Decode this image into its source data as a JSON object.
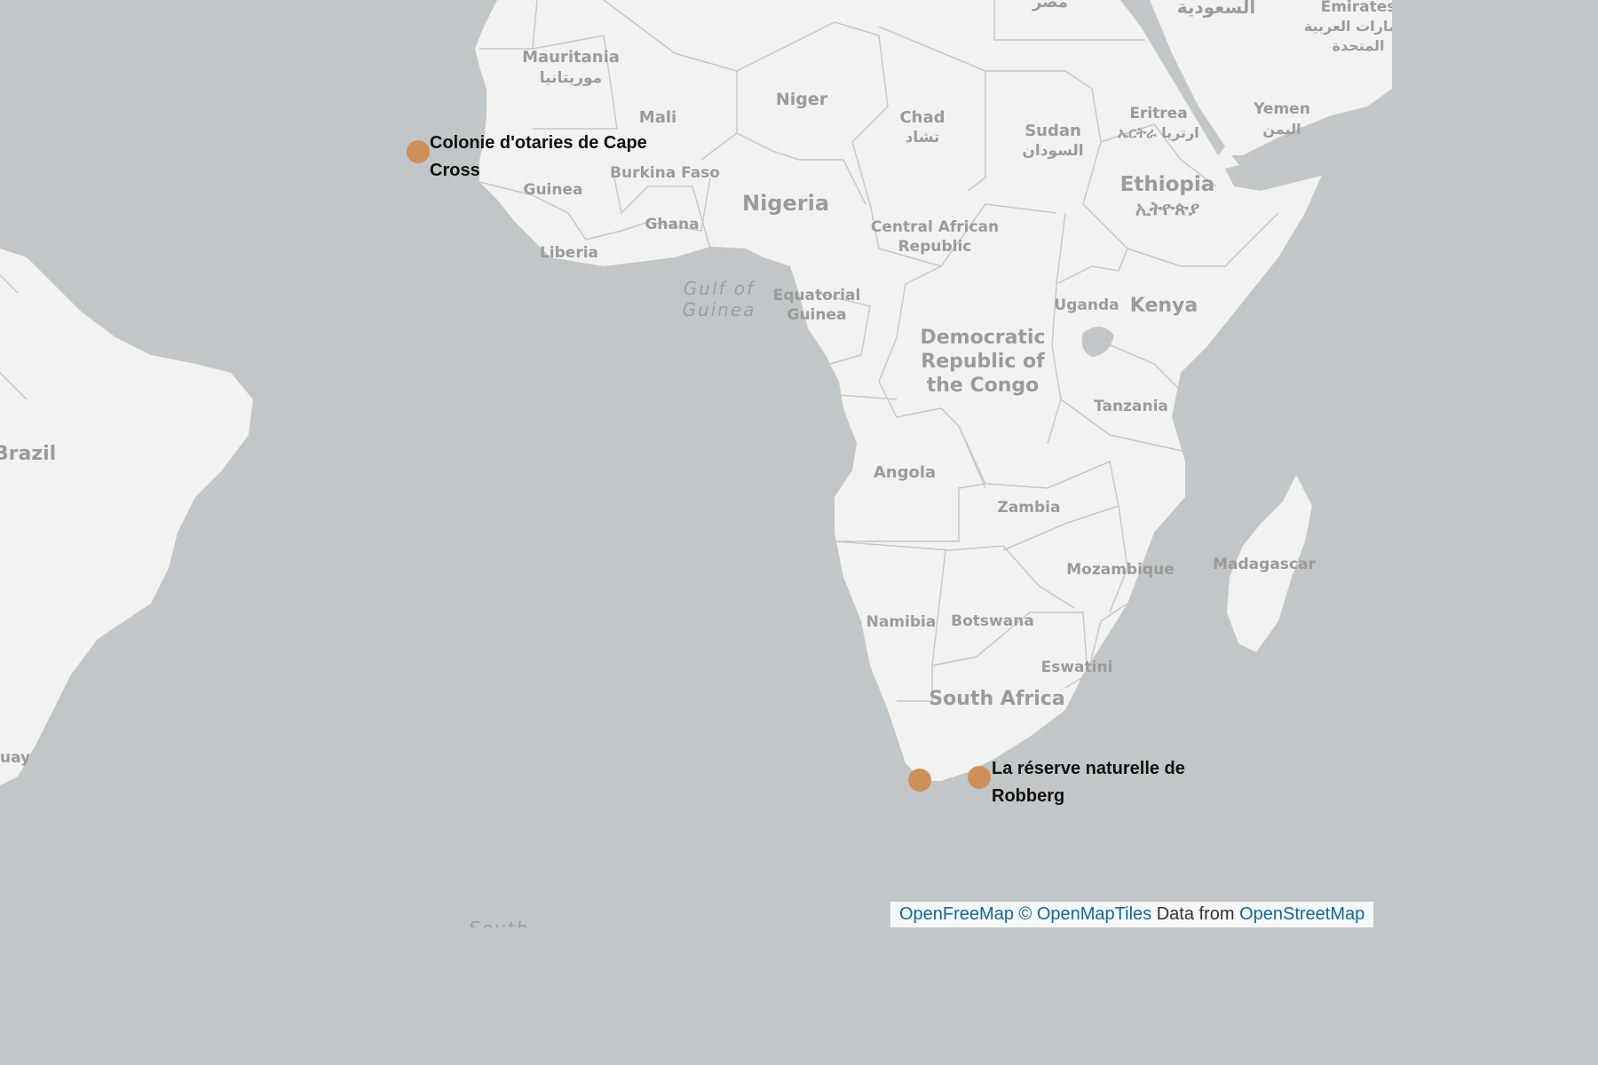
{
  "map": {
    "countries": [
      {
        "name": "Mauritania",
        "native": "موريتانيا"
      },
      {
        "name": "Mali"
      },
      {
        "name": "Niger"
      },
      {
        "name": "Chad",
        "native": "تشاد"
      },
      {
        "name": "Sudan",
        "native": "السودان"
      },
      {
        "name": "Eritrea",
        "native": "ኤርትራ ارتريا"
      },
      {
        "name": "Yemen",
        "native": "اليمن"
      },
      {
        "name": "Ethiopia",
        "native": "ኢትዮጵያ"
      },
      {
        "name": "Nigeria"
      },
      {
        "name": "Guinea"
      },
      {
        "name": "Burkina Faso"
      },
      {
        "name": "Ghana"
      },
      {
        "name": "Liberia"
      },
      {
        "name": "Central African Republic"
      },
      {
        "name": "Equatorial Guinea"
      },
      {
        "name": "Uganda"
      },
      {
        "name": "Kenya"
      },
      {
        "name": "Democratic Republic of the Congo"
      },
      {
        "name": "Tanzania"
      },
      {
        "name": "Angola"
      },
      {
        "name": "Zambia"
      },
      {
        "name": "Mozambique"
      },
      {
        "name": "Madagascar"
      },
      {
        "name": "Namibia"
      },
      {
        "name": "Botswana"
      },
      {
        "name": "Eswatini"
      },
      {
        "name": "South Africa"
      },
      {
        "name": "Brazil"
      },
      {
        "name": "uay"
      },
      {
        "name": "مصر"
      },
      {
        "name": "السعودية"
      },
      {
        "name": "Emirates",
        "native": "الإمارات العربية المتحدة"
      }
    ],
    "water_bodies": [
      {
        "name": "Gulf of Guinea"
      },
      {
        "name": "South"
      }
    ],
    "markers": [
      {
        "label_line1": "Colonie d'otaries de Cape",
        "label_line2": "Cross",
        "color": "#cf8f5a"
      },
      {
        "label_line1": "",
        "label_line2": "",
        "color": "#cf8f5a"
      },
      {
        "label_line1": "La réserve naturelle de",
        "label_line2": "Robberg",
        "color": "#cf8f5a"
      }
    ],
    "colors": {
      "land": "#f2f2f0",
      "water": "#c1c6c8",
      "border": "#c8c8c8",
      "marker": "#cf8f5a"
    }
  },
  "attribution": {
    "openfreemap": "OpenFreeMap",
    "openmaptiles": "© OpenMapTiles",
    "data_from": "Data from",
    "openstreetmap": "OpenStreetMap"
  }
}
